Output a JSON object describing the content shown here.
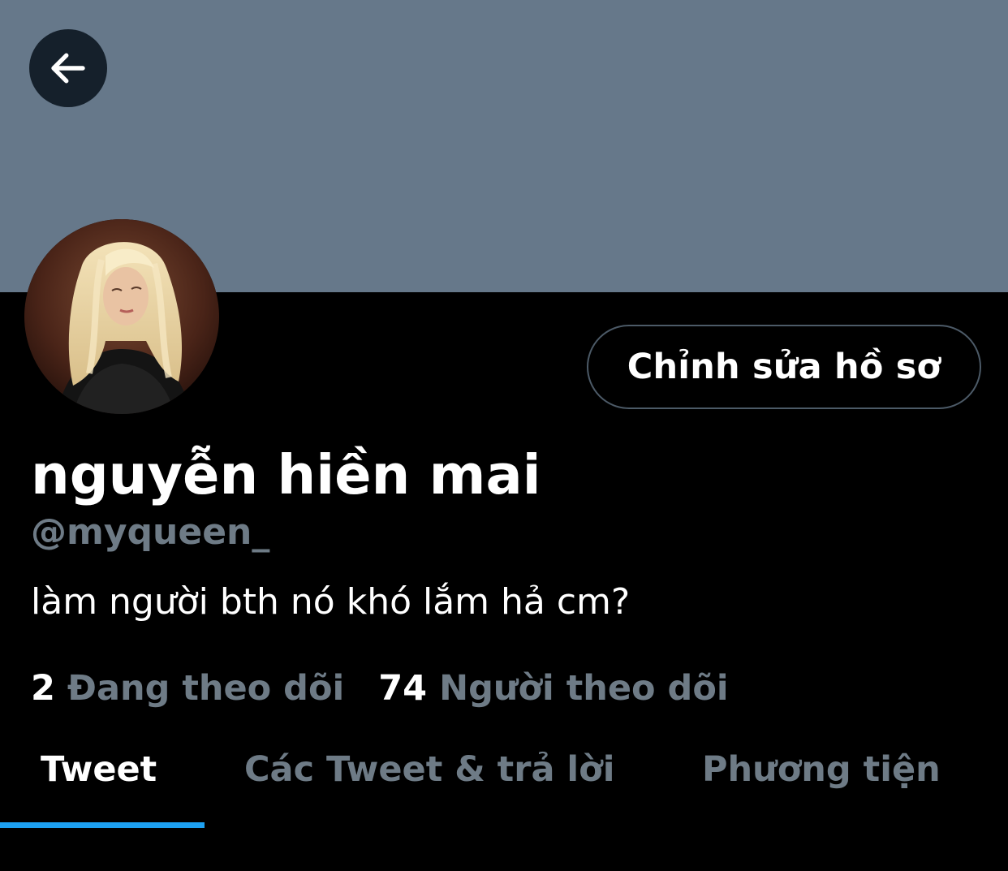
{
  "profile": {
    "display_name": "nguyễn hiền mai",
    "handle": "@myqueen_",
    "bio": "làm người bth nó khó lắm hả cm?",
    "banner_color": "#66788a"
  },
  "header": {
    "back_icon": "arrow-left-icon"
  },
  "actions": {
    "edit_profile_label": "Chỉnh sửa hồ sơ"
  },
  "stats": {
    "following_count": "2",
    "following_label": "Đang theo dõi",
    "followers_count": "74",
    "followers_label": "Người theo dõi"
  },
  "tabs": [
    {
      "label": "Tweet",
      "active": true
    },
    {
      "label": "Các Tweet & trả lời",
      "active": false
    },
    {
      "label": "Phương tiện",
      "active": false
    }
  ],
  "colors": {
    "accent": "#1da1f2",
    "muted_text": "#6e7b86",
    "background": "#000000"
  }
}
